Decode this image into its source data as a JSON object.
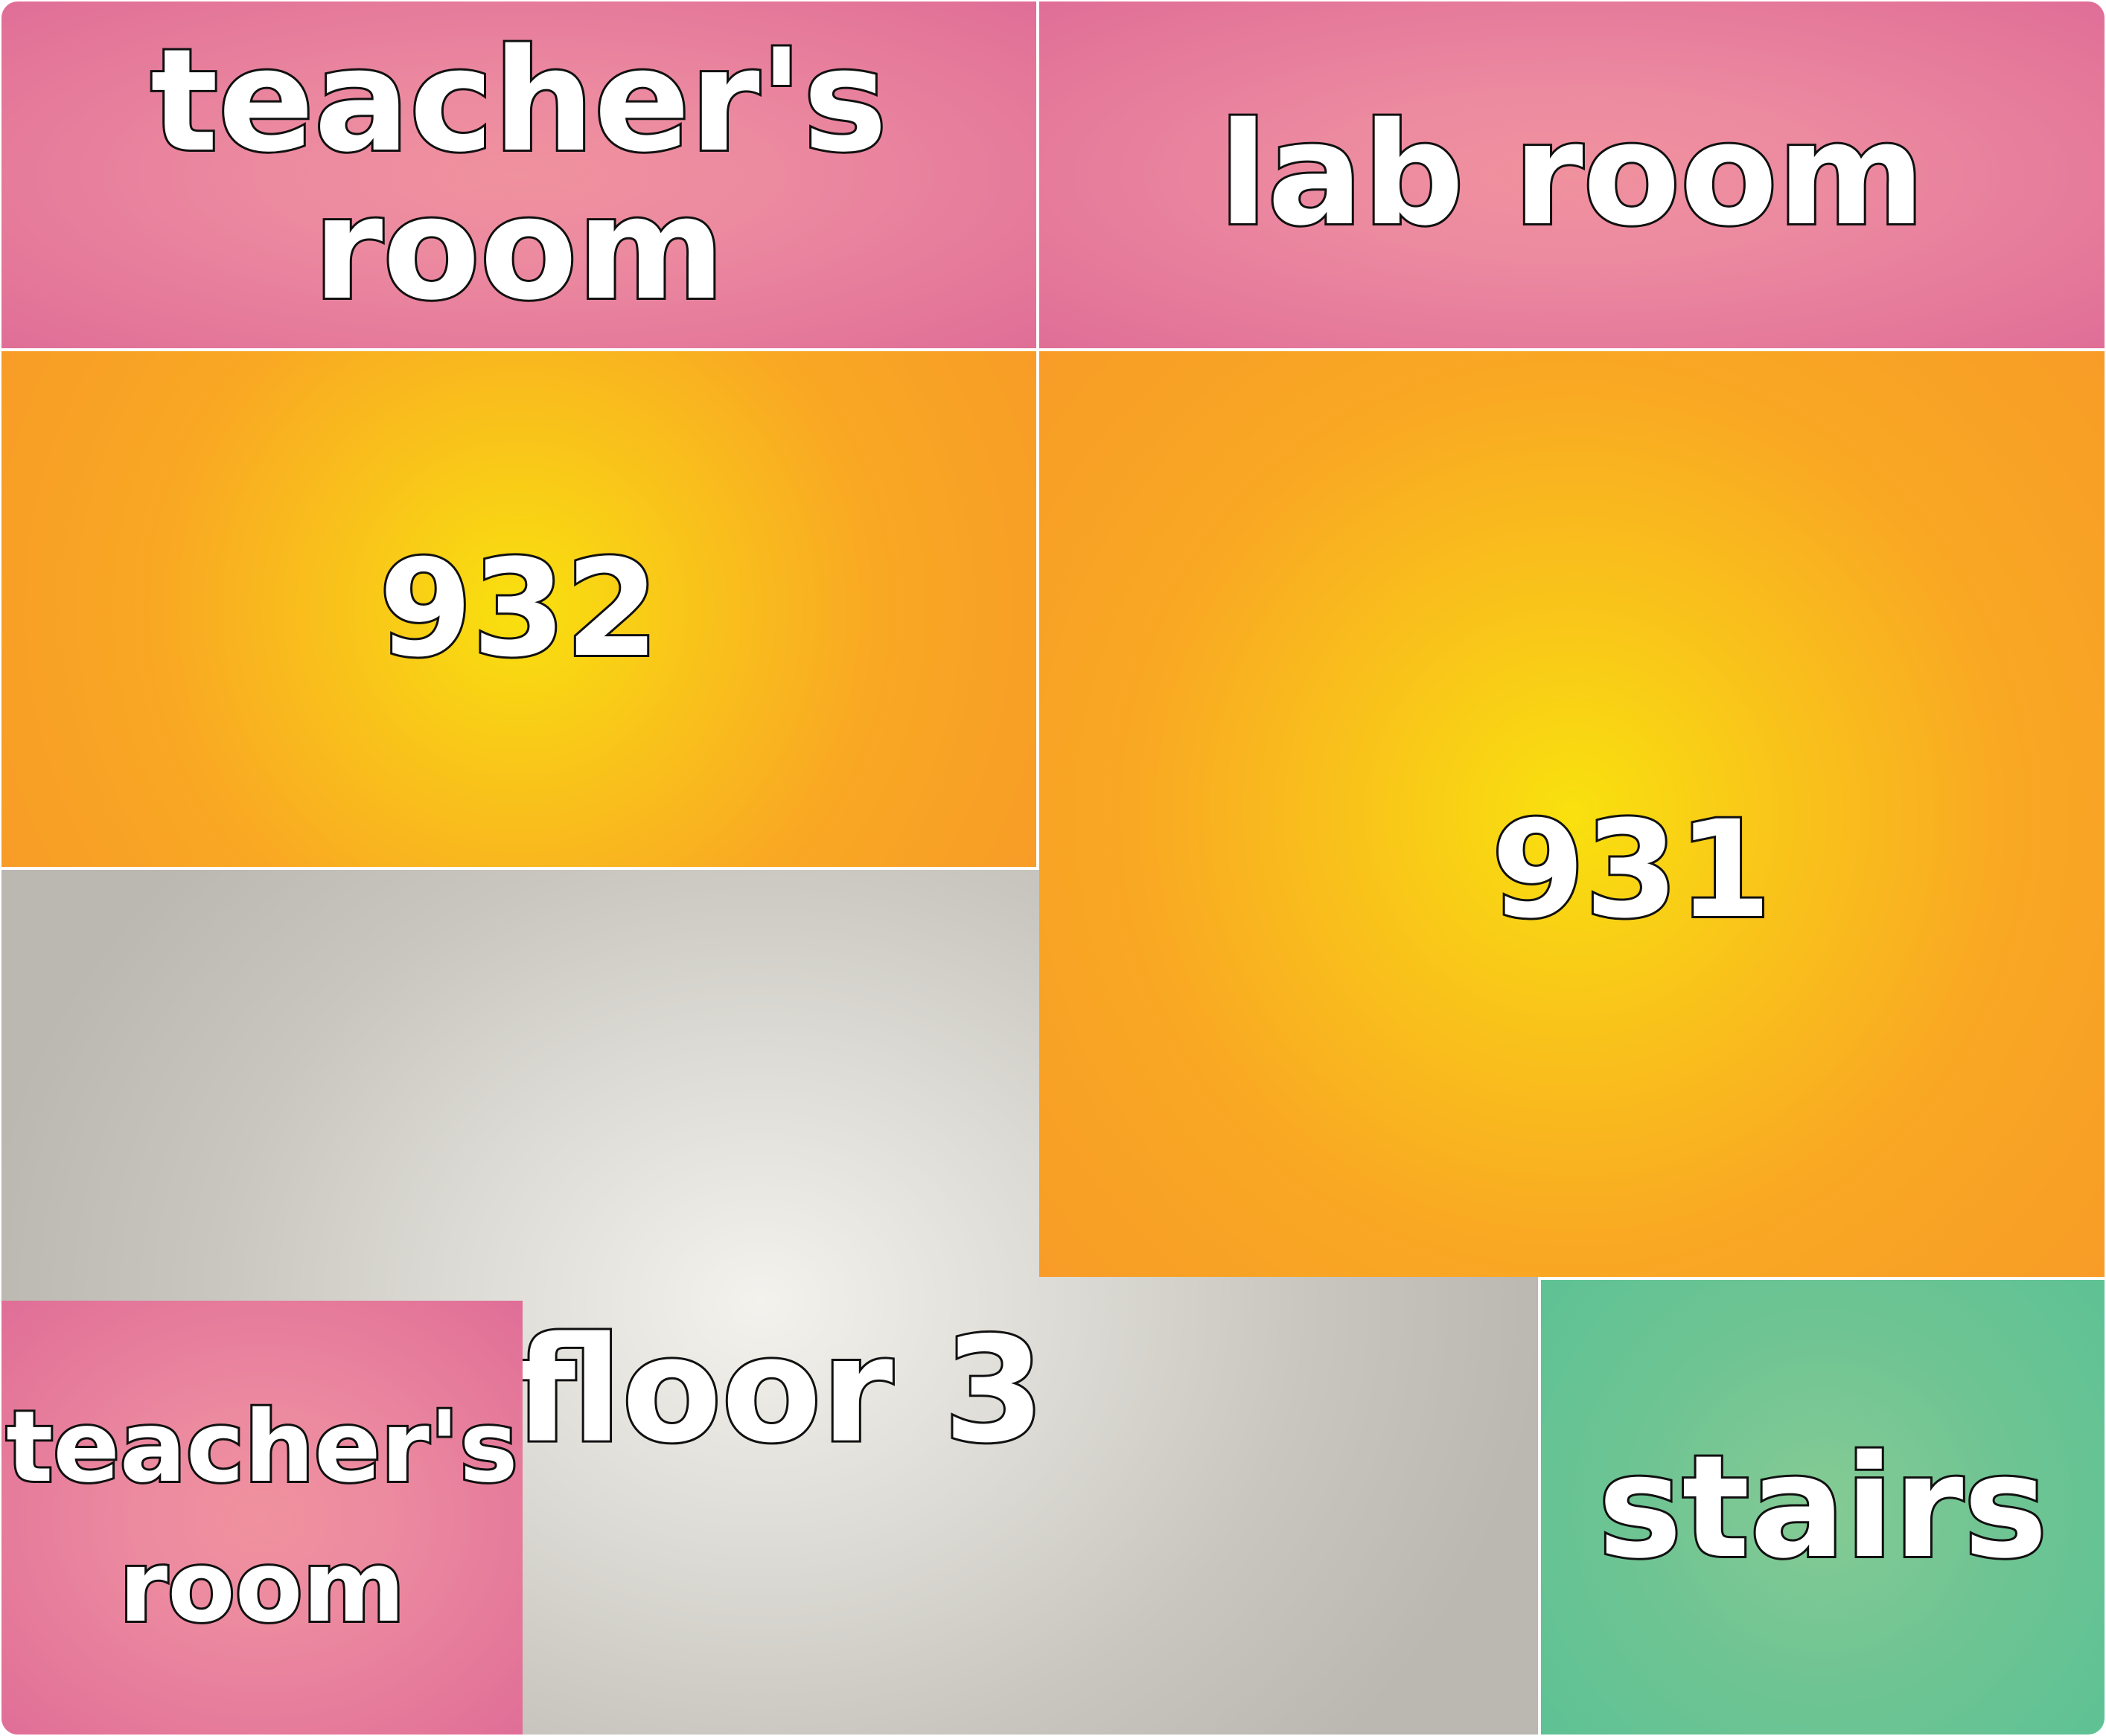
{
  "map": {
    "rooms": {
      "teachers_room_top": {
        "label": "teacher's room",
        "color": "#e6789c"
      },
      "lab_room": {
        "label": "lab room",
        "color": "#e6789c"
      },
      "room_932": {
        "label": "932",
        "color": "#f9b020"
      },
      "room_931": {
        "label": "931",
        "color": "#f9b020"
      },
      "floor": {
        "label": "floor 3",
        "color": "#d6d3cc"
      },
      "teachers_room_bottom": {
        "label": "teacher's\nroom",
        "color": "#e6789c"
      },
      "stairs": {
        "label": "stairs",
        "color": "#6fc493"
      }
    }
  }
}
